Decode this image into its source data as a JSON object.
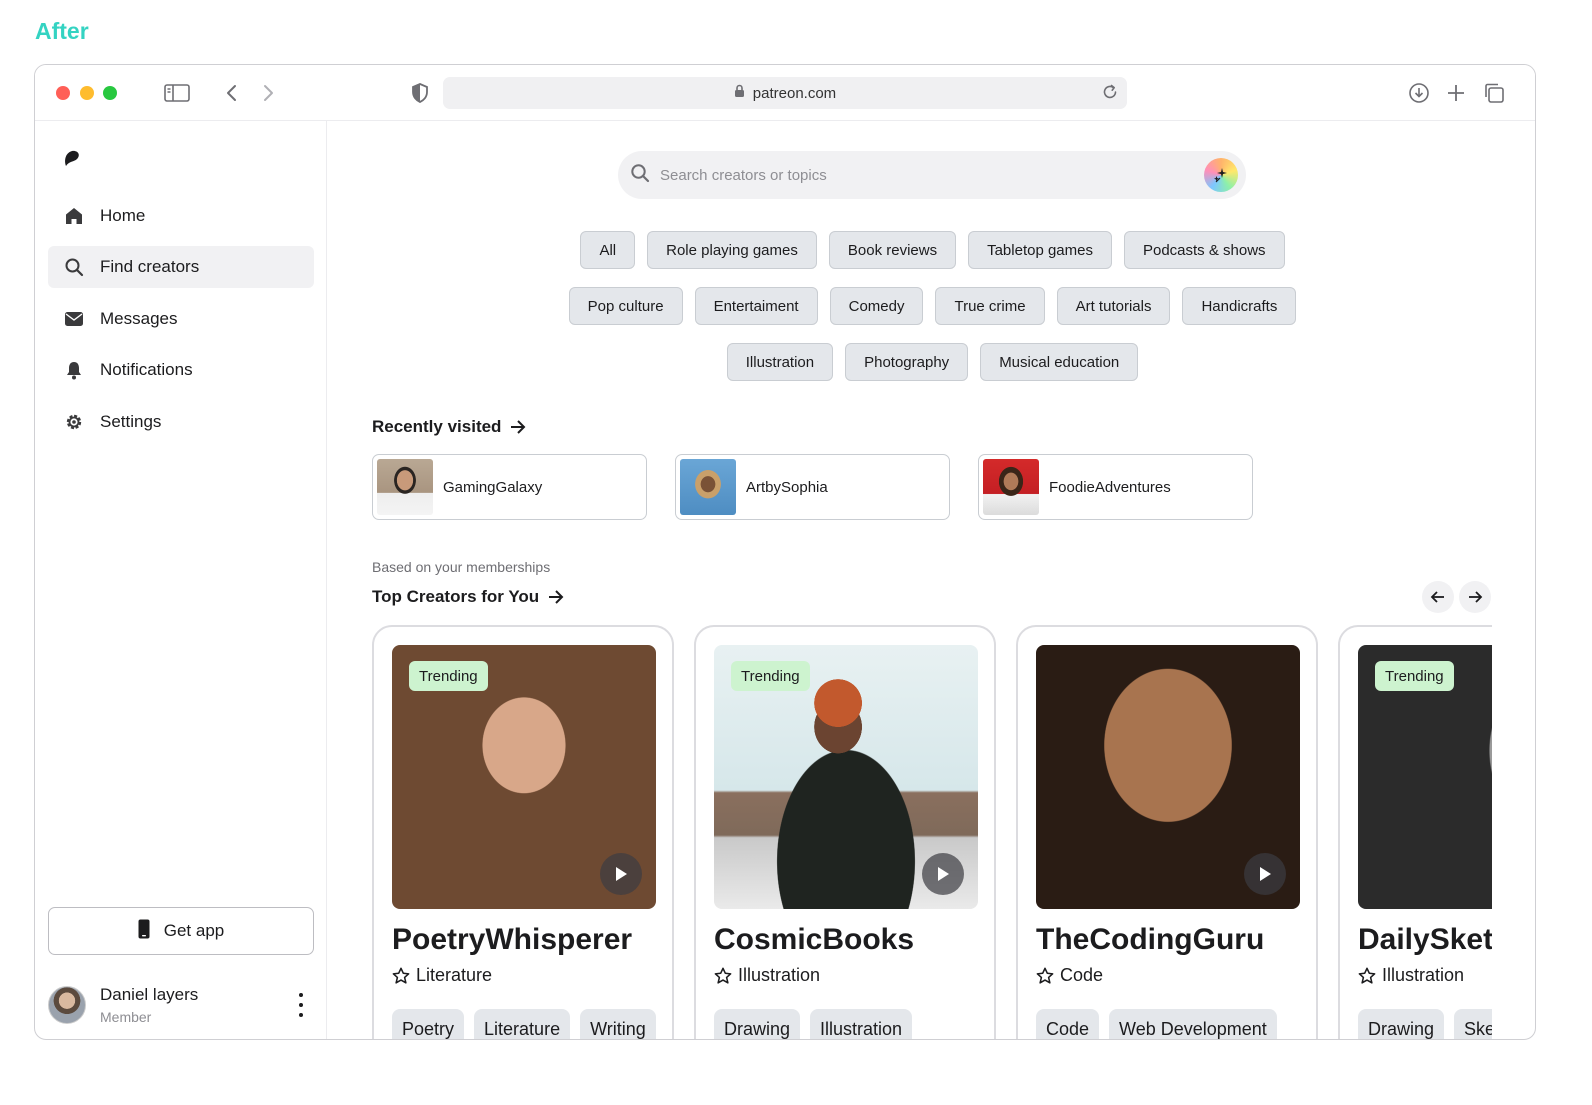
{
  "page_heading": "After",
  "browser": {
    "url": "patreon.com"
  },
  "sidebar": {
    "items": [
      {
        "label": "Home",
        "icon": "home-icon"
      },
      {
        "label": "Find creators",
        "icon": "search-icon",
        "active": true
      },
      {
        "label": "Messages",
        "icon": "envelope-icon"
      },
      {
        "label": "Notifications",
        "icon": "bell-icon"
      },
      {
        "label": "Settings",
        "icon": "gear-icon"
      }
    ],
    "get_app_label": "Get app",
    "user": {
      "name": "Daniel layers",
      "role": "Member"
    }
  },
  "search": {
    "placeholder": "Search creators or topics"
  },
  "categories": {
    "row1": [
      "All",
      "Role playing games",
      "Book reviews",
      "Tabletop games",
      "Podcasts & shows"
    ],
    "row2": [
      "Pop culture",
      "Entertaiment",
      "Comedy",
      "True crime",
      "Art tutorials",
      "Handicrafts"
    ],
    "row3": [
      "Illustration",
      "Photography",
      "Musical education"
    ]
  },
  "recently_visited": {
    "title": "Recently visited",
    "items": [
      {
        "name": "GamingGalaxy"
      },
      {
        "name": "ArtbySophia"
      },
      {
        "name": "FoodieAdventures"
      }
    ]
  },
  "top_creators": {
    "subtitle": "Based on your memberships",
    "title": "Top Creators for You",
    "cards": [
      {
        "name": "PoetryWhisperer",
        "category": "Literature",
        "badge": "Trending",
        "tags": [
          "Poetry",
          "Literature",
          "Writing"
        ]
      },
      {
        "name": "CosmicBooks",
        "category": "Illustration",
        "badge": "Trending",
        "tags": [
          "Drawing",
          "Illustration"
        ]
      },
      {
        "name": "TheCodingGuru",
        "category": "Code",
        "badge": "",
        "tags": [
          "Code",
          "Web Development"
        ]
      },
      {
        "name": "DailySketch",
        "category": "Illustration",
        "badge": "Trending",
        "tags": [
          "Drawing",
          "Sketching"
        ]
      }
    ]
  },
  "colors": {
    "heading_accent": "#34d3c2",
    "badge_bg": "#cdf3cf",
    "chip_bg": "#e4e7eb"
  }
}
